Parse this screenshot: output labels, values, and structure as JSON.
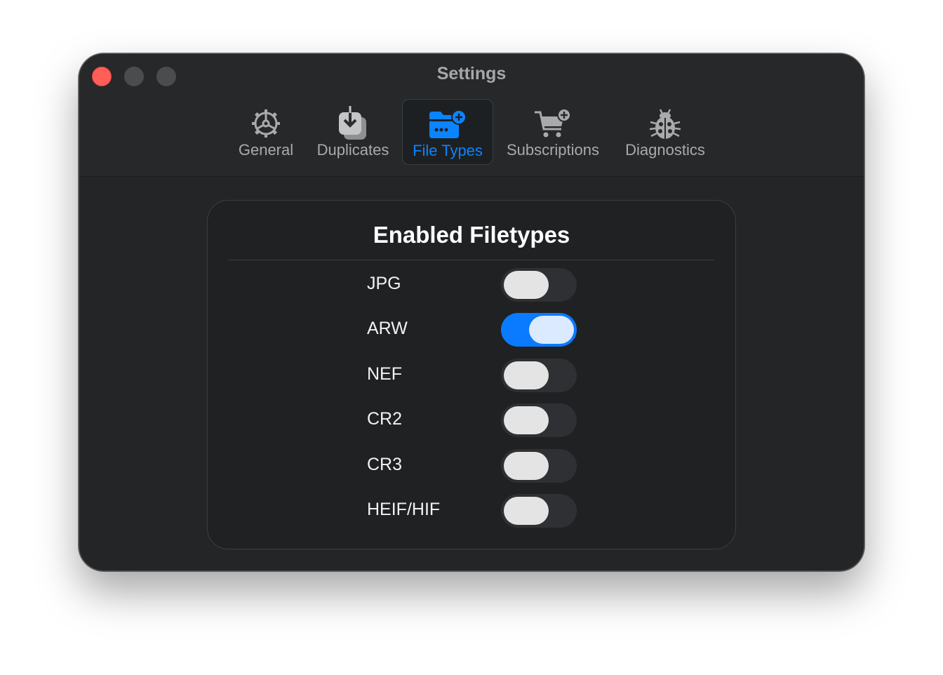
{
  "window": {
    "title": "Settings"
  },
  "tabs": [
    {
      "label": "General",
      "icon": "gear-icon",
      "active": false
    },
    {
      "label": "Duplicates",
      "icon": "duplicates-download-icon",
      "active": false
    },
    {
      "label": "File Types",
      "icon": "folder-plus-icon",
      "active": true
    },
    {
      "label": "Subscriptions",
      "icon": "cart-plus-icon",
      "active": false
    },
    {
      "label": "Diagnostics",
      "icon": "ladybug-icon",
      "active": false
    }
  ],
  "panel": {
    "title": "Enabled Filetypes",
    "filetypes": [
      {
        "label": "JPG",
        "enabled": false
      },
      {
        "label": "ARW",
        "enabled": true
      },
      {
        "label": "NEF",
        "enabled": false
      },
      {
        "label": "CR2",
        "enabled": false
      },
      {
        "label": "CR3",
        "enabled": false
      },
      {
        "label": "HEIF/HIF",
        "enabled": false
      }
    ]
  },
  "colors": {
    "accent": "#0a84ff",
    "close_button": "#ff5f57",
    "window_bg": "#232527"
  }
}
